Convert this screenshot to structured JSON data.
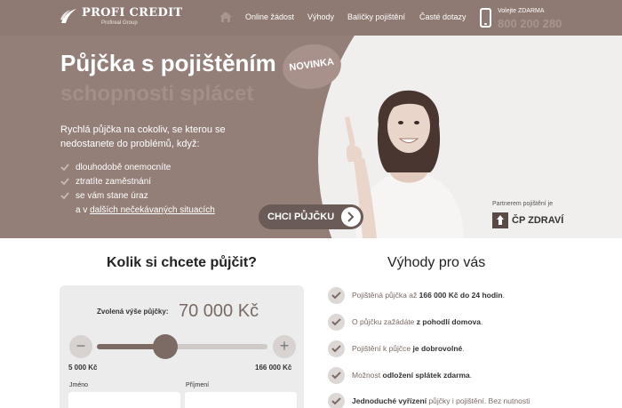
{
  "header": {
    "logo_name": "PROFI CREDIT",
    "logo_sub": "Profireal Group",
    "nav": [
      "Online žádost",
      "Výhody",
      "Balíčky pojištění",
      "Časté dotazy"
    ],
    "call_label": "Volejte ZDARMA",
    "call_number": "800 200 280"
  },
  "hero": {
    "title": "Půjčka s pojištěním",
    "subtitle": "schopnosti splácet",
    "badge": "NOVINKA",
    "intro": "Rychlá půjčka na cokoliv, se kterou se nedostanete do problémů, když:",
    "conditions": [
      "dlouhodobě onemocníte",
      "ztratíte zaměstnání",
      "se vám stane úraz"
    ],
    "last_prefix": "a v ",
    "last_link": "dalších nečekávaných situacích",
    "cta": "CHCI PŮJČKU",
    "partner_label": "Partnerem pojištění je",
    "partner_name": "ČP ZDRAVÍ"
  },
  "calculator": {
    "title": "Kolik si chcete půjčit?",
    "amount_label": "Zvolená výše půjčky:",
    "amount_value": "70 000 Kč",
    "min_label": "5 000 Kč",
    "max_label": "166 000 Kč",
    "slider_fraction": 0.4,
    "name_label": "Jméno",
    "surname_label": "Příjmení",
    "minus": "−",
    "plus": "+"
  },
  "benefits": {
    "title": "Výhody pro vás",
    "items": [
      {
        "pre": "Pojištěná půjčka až ",
        "bold": "166 000 Kč do 24 hodin",
        "post": "."
      },
      {
        "pre": "O půjčku zažádáte ",
        "bold": "z pohodlí domova",
        "post": "."
      },
      {
        "pre": "Pojištění k půjčce ",
        "bold": "je dobrovolné",
        "post": "."
      },
      {
        "pre": "Možnost ",
        "bold": "odložení splátek zdarma",
        "post": "."
      },
      {
        "pre": "",
        "bold": "Jednoduché vyřízení",
        "post": " půjčky i pojištění. Bez nutnosti"
      }
    ]
  },
  "colors": {
    "header_bg": "#8f7a73",
    "hero_bg": "#947f78",
    "accent": "#7c6b65"
  }
}
